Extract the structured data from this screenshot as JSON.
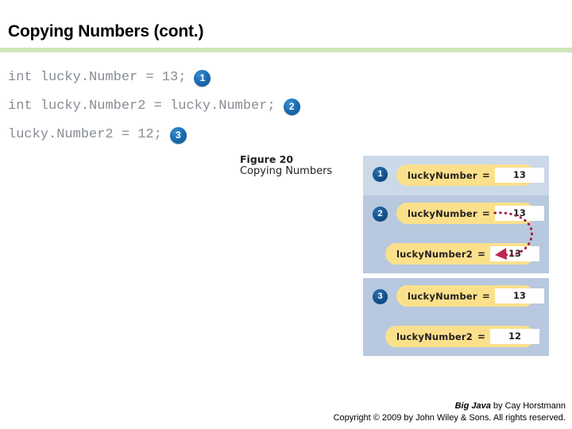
{
  "slide": {
    "title": "Copying Numbers (cont.)",
    "rule_color": "#cee6ba"
  },
  "code": {
    "text_color": "#878d94",
    "lines": [
      {
        "text": "int lucky.Number = 13;",
        "badge": "1"
      },
      {
        "text": "int lucky.Number2 = lucky.Number;",
        "badge": "2"
      },
      {
        "text": "lucky.Number2 = 12;",
        "badge": "3"
      }
    ]
  },
  "figure": {
    "number": "Figure 20",
    "title": "Copying Numbers",
    "panel_color": "#b8c8de",
    "panel_color_light": "#cbd9e8",
    "pill_color": "#fbe08c",
    "arrow_color": "#9e1f4b",
    "panels": [
      {
        "badge": "1",
        "variables": [
          {
            "name": "luckyNumber",
            "eq": "=",
            "value": "13"
          }
        ]
      },
      {
        "badge": "2",
        "variables": [
          {
            "name": "luckyNumber",
            "eq": "=",
            "value": "13"
          },
          {
            "name": "luckyNumber2",
            "eq": "=",
            "value": "13"
          }
        ]
      },
      {
        "badge": "3",
        "variables": [
          {
            "name": "luckyNumber",
            "eq": "=",
            "value": "13"
          },
          {
            "name": "luckyNumber2",
            "eq": "=",
            "value": "12"
          }
        ]
      }
    ]
  },
  "footer": {
    "book": "Big Java",
    "byline": " by  Cay Horstmann",
    "copyright": "Copyright © 2009 by John Wiley & Sons.  All rights reserved."
  }
}
